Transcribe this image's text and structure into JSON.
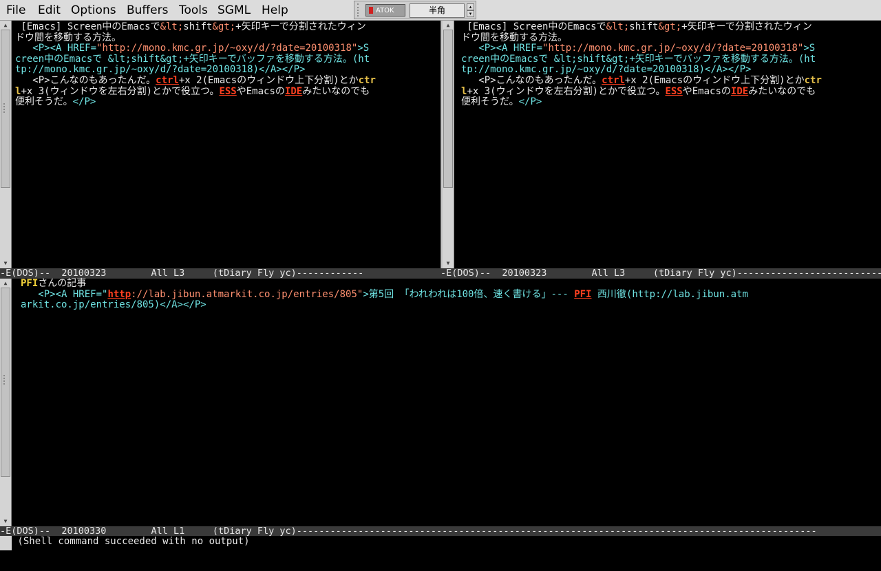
{
  "menu": {
    "items": [
      "File",
      "Edit",
      "Options",
      "Buffers",
      "Tools",
      "SGML",
      "Help"
    ]
  },
  "input_method": {
    "logo": "ATOK",
    "mode": "半角",
    "up_arrow": "▴",
    "down_arrow": "▾"
  },
  "top_left_window": {
    "lines": [
      [
        {
          "t": " [Emacs] Screen中のEmacsで",
          "c": "t-gray"
        },
        {
          "t": "&lt;",
          "c": "t-salmon"
        },
        {
          "t": "shift",
          "c": "t-gray"
        },
        {
          "t": "&gt;",
          "c": "t-salmon"
        },
        {
          "t": "+矢印キーで分割されたウィン",
          "c": "t-gray"
        }
      ],
      [
        {
          "t": "ドウ間を移動する方法。",
          "c": "t-gray"
        }
      ],
      [
        {
          "t": "   ",
          "c": "t-gray"
        },
        {
          "t": "<P><A HREF=",
          "c": "t-cyan"
        },
        {
          "t": "\"http://mono.kmc.gr.jp/~oxy/d/?date=20100318\"",
          "c": "t-salmon"
        },
        {
          "t": ">S",
          "c": "t-cyan"
        }
      ],
      [
        {
          "t": "creen中のEmacsで &lt;shift&gt;+矢印キーでバッファを移動する方法。(ht",
          "c": "t-cyan"
        }
      ],
      [
        {
          "t": "tp://mono.kmc.gr.jp/~oxy/d/?date=20100318)",
          "c": "t-cyan"
        },
        {
          "t": "</A></P>",
          "c": "t-cyan"
        }
      ],
      [
        {
          "t": "   <P>こんなのもあったんだ。",
          "c": "t-gray"
        },
        {
          "t": "ctrl",
          "c": "t-red"
        },
        {
          "t": "+x 2(Emacsのウィンドウ上下分割)とか",
          "c": "t-gray"
        },
        {
          "t": "ctr",
          "c": "t-gold"
        }
      ],
      [
        {
          "t": "l",
          "c": "t-gold"
        },
        {
          "t": "+x 3(ウィンドウを左右分割)とかで役立つ。",
          "c": "t-gray"
        },
        {
          "t": "ESS",
          "c": "t-red"
        },
        {
          "t": "やEmacsの",
          "c": "t-gray"
        },
        {
          "t": "IDE",
          "c": "t-red"
        },
        {
          "t": "みたいなのでも",
          "c": "t-gray"
        }
      ],
      [
        {
          "t": "便利そうだ。",
          "c": "t-gray"
        },
        {
          "t": "</P>",
          "c": "t-cyan"
        }
      ]
    ]
  },
  "top_right_window": {
    "lines": [
      [
        {
          "t": " [Emacs] Screen中のEmacsで",
          "c": "t-gray"
        },
        {
          "t": "&lt;",
          "c": "t-salmon"
        },
        {
          "t": "shift",
          "c": "t-gray"
        },
        {
          "t": "&gt;",
          "c": "t-salmon"
        },
        {
          "t": "+矢印キーで分割されたウィン",
          "c": "t-gray"
        }
      ],
      [
        {
          "t": "ドウ間を移動する方法。",
          "c": "t-gray"
        }
      ],
      [
        {
          "t": "   ",
          "c": "t-gray"
        },
        {
          "t": "<P><A HREF=",
          "c": "t-cyan"
        },
        {
          "t": "\"http://mono.kmc.gr.jp/~oxy/d/?date=20100318\"",
          "c": "t-salmon"
        },
        {
          "t": ">S",
          "c": "t-cyan"
        }
      ],
      [
        {
          "t": "creen中のEmacsで &lt;shift&gt;+矢印キーでバッファを移動する方法。(ht",
          "c": "t-cyan"
        }
      ],
      [
        {
          "t": "tp://mono.kmc.gr.jp/~oxy/d/?date=20100318)",
          "c": "t-cyan"
        },
        {
          "t": "</A></P>",
          "c": "t-cyan"
        }
      ],
      [
        {
          "t": "   <P>こんなのもあったんだ。",
          "c": "t-gray"
        },
        {
          "t": "ctrl",
          "c": "t-red"
        },
        {
          "t": "+x 2(Emacsのウィンドウ上下分割)とか",
          "c": "t-gray"
        },
        {
          "t": "ctr",
          "c": "t-gold"
        }
      ],
      [
        {
          "t": "l",
          "c": "t-gold"
        },
        {
          "t": "+x 3(ウィンドウを左右分割)とかで役立つ。",
          "c": "t-gray"
        },
        {
          "t": "ESS",
          "c": "t-red"
        },
        {
          "t": "やEmacsの",
          "c": "t-gray"
        },
        {
          "t": "IDE",
          "c": "t-red"
        },
        {
          "t": "みたいなのでも",
          "c": "t-gray"
        }
      ],
      [
        {
          "t": "便利そうだ。",
          "c": "t-gray"
        },
        {
          "t": "</P>",
          "c": "t-cyan"
        }
      ]
    ]
  },
  "bottom_window": {
    "lines": [
      [
        {
          "t": "PFI",
          "c": "t-yellow"
        },
        {
          "t": "さんの記事",
          "c": "t-gray"
        }
      ],
      [
        {
          "t": "   <P><A HREF=\"",
          "c": "t-cyan"
        },
        {
          "t": "http",
          "c": "t-red"
        },
        {
          "t": "://lab.jibun.atmarkit.co.jp/entries/805\"",
          "c": "t-salmon"
        },
        {
          "t": ">第5回 「われわれは100倍、速く書ける」--- ",
          "c": "t-cyan"
        },
        {
          "t": "PFI",
          "c": "t-red"
        },
        {
          "t": " 西川徹(http://lab.jibun.atm",
          "c": "t-cyan"
        }
      ],
      [
        {
          "t": "arkit.co.jp/entries/805)</A></P>",
          "c": "t-cyan"
        }
      ]
    ]
  },
  "modelines": {
    "top_left": "-E(DOS)--  20100323        All L3     (tDiary Fly yc)------------",
    "top_right": "-E(DOS)--  20100323        All L3     (tDiary Fly yc)-------------------------------",
    "bottom": "-E(DOS)--  20100330        All L1     (tDiary Fly yc)---------------------------------------------------------------------------------------------"
  },
  "minibuffer": {
    "message": " (Shell command succeeded with no output)"
  }
}
